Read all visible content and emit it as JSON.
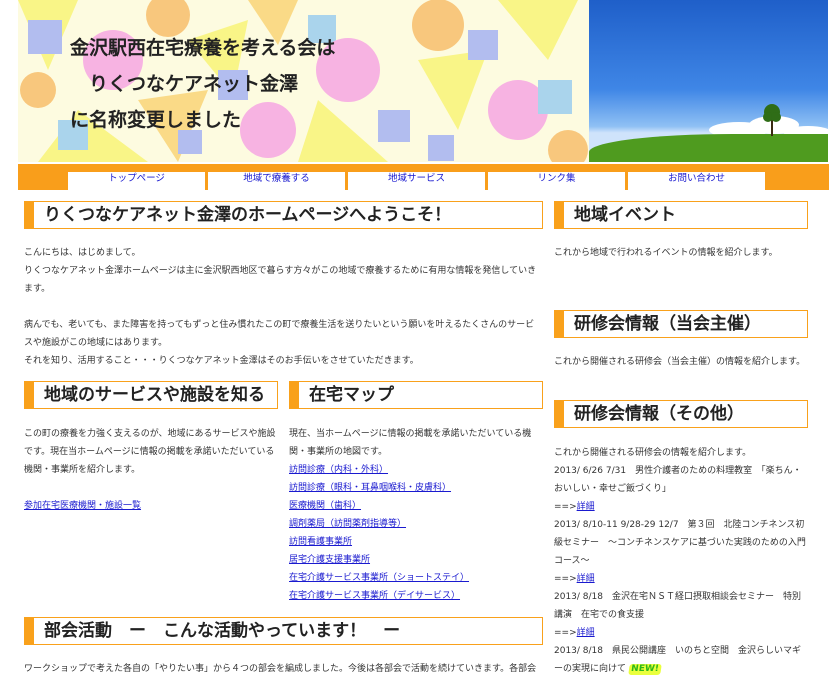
{
  "header": {
    "title_lines": [
      "金沢駅西在宅療養を考える会は",
      "　りくつなケアネット金澤",
      "に名称変更しました"
    ]
  },
  "nav": {
    "items": [
      "トップページ",
      "地域で療養する",
      "地域サービス",
      "リンク集",
      "お問い合わせ"
    ]
  },
  "main": {
    "welcome_heading": "りくつなケアネット金澤のホームページへようこそ！",
    "welcome_paragraphs": [
      "こんにちは、はじめまして。",
      "りくつなケアネット金澤ホームページは主に金沢駅西地区で暮らす方々がこの地域で療養するために有用な情報を発信していきます。",
      "病んでも、老いても、また障害を持ってもずっと住み慣れたこの町で療養生活を送りたいという願いを叶えるたくさんのサービスや施設がこの地域にはあります。",
      "それを知り、活用すること・・・りくつなケアネット金澤はそのお手伝いをさせていただきます。"
    ],
    "services": {
      "heading": "地域のサービスや施設を知る",
      "text": "この町の療養を力強く支えるのが、地域にあるサービスや施設です。現在当ホームページに情報の掲載を承諾いただいている機関・事業所を紹介します。",
      "link": "参加在宅医療機関・施設一覧"
    },
    "map": {
      "heading": "在宅マップ",
      "text": "現在、当ホームページに情報の掲載を承諾いただいている機関・事業所の地図です。",
      "links": [
        "訪問診療（内科・外科）",
        "訪問診療（眼科・耳鼻咽喉科・皮膚科）",
        "医療機関（歯科）",
        "調剤薬局（訪問薬剤指導等）",
        "訪問看護事業所",
        "居宅介護支援事業所",
        "在宅介護サービス事業所（ショートステイ）",
        "在宅介護サービス事業所（デイサービス）"
      ]
    },
    "bukai": {
      "heading": "部会活動　ー　こんな活動やっています！　ー",
      "text": "ワークショップで考えた各自の「やりたい事」から４つの部会を編成しました。今後は各部会で活動を続けていきます。各部会"
    }
  },
  "sidebar": {
    "events": {
      "heading": "地域イベント",
      "text": "これから地域で行われるイベントの情報を紹介します。"
    },
    "training_own": {
      "heading": "研修会情報（当会主催）",
      "text": "これから開催される研修会（当会主催）の情報を紹介します。"
    },
    "training_other": {
      "heading": "研修会情報（その他）",
      "intro": "これから開催される研修会の情報を紹介します。",
      "entries": [
        {
          "text": "2013/ 6/26 7/31　男性介護者のための料理教室　「楽ちん・おいしい・幸せご飯づくり」",
          "arrow": "==>",
          "link": "詳細"
        },
        {
          "text": "2013/ 8/10-11 9/28-29 12/7　第３回　北陸コンチネンス初級セミナー　〜コンチネンスケアに基づいた実践のための入門コース〜",
          "arrow": "==>",
          "link": "詳細"
        },
        {
          "text": "2013/ 8/18　金沢在宅ＮＳＴ経口摂取相談会セミナー　特別講演　在宅での食支援",
          "arrow": "==>",
          "link": "詳細"
        },
        {
          "text": "2013/ 8/18　県民公開講座　いのちと空間　金沢らしいマギーの実現に向けて",
          "badge": "NEW!"
        }
      ]
    }
  },
  "colors": {
    "accent": "#f9a11b",
    "link": "#1a1acf"
  }
}
